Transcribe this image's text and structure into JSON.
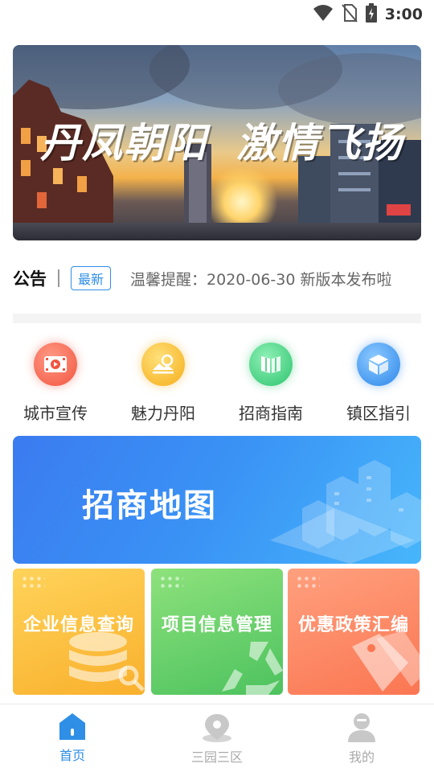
{
  "status_bar": {
    "time": "3:00",
    "icons": [
      "wifi-icon",
      "no-sim-icon",
      "battery-charging-icon"
    ]
  },
  "banner": {
    "title_left": "丹凤朝阳",
    "title_right": "激情飞扬"
  },
  "notice": {
    "label": "公告",
    "badge": "最新",
    "text": "温馨提醒：2020-06-30 新版本发布啦"
  },
  "quick_nav": [
    {
      "label": "城市宣传",
      "icon": "video-icon",
      "color": "#f2553f"
    },
    {
      "label": "魅力丹阳",
      "icon": "landscape-icon",
      "color": "#f5ae1a"
    },
    {
      "label": "招商指南",
      "icon": "book-icon",
      "color": "#2ec46f"
    },
    {
      "label": "镇区指引",
      "icon": "cube-icon",
      "color": "#2c86ea"
    }
  ],
  "map_banner": {
    "title": "招商地图"
  },
  "cards": [
    {
      "label": "企业信息查询",
      "icon": "database-search-icon"
    },
    {
      "label": "项目信息管理",
      "icon": "recycle-triangle-icon"
    },
    {
      "label": "优惠政策汇编",
      "icon": "price-tag-icon"
    }
  ],
  "tab_bar": [
    {
      "label": "首页",
      "icon": "home-icon",
      "active": true
    },
    {
      "label": "三园三区",
      "icon": "location-pin-icon",
      "active": false
    },
    {
      "label": "我的",
      "icon": "user-icon",
      "active": false
    }
  ],
  "colors": {
    "accent": "#2f8ee6"
  }
}
